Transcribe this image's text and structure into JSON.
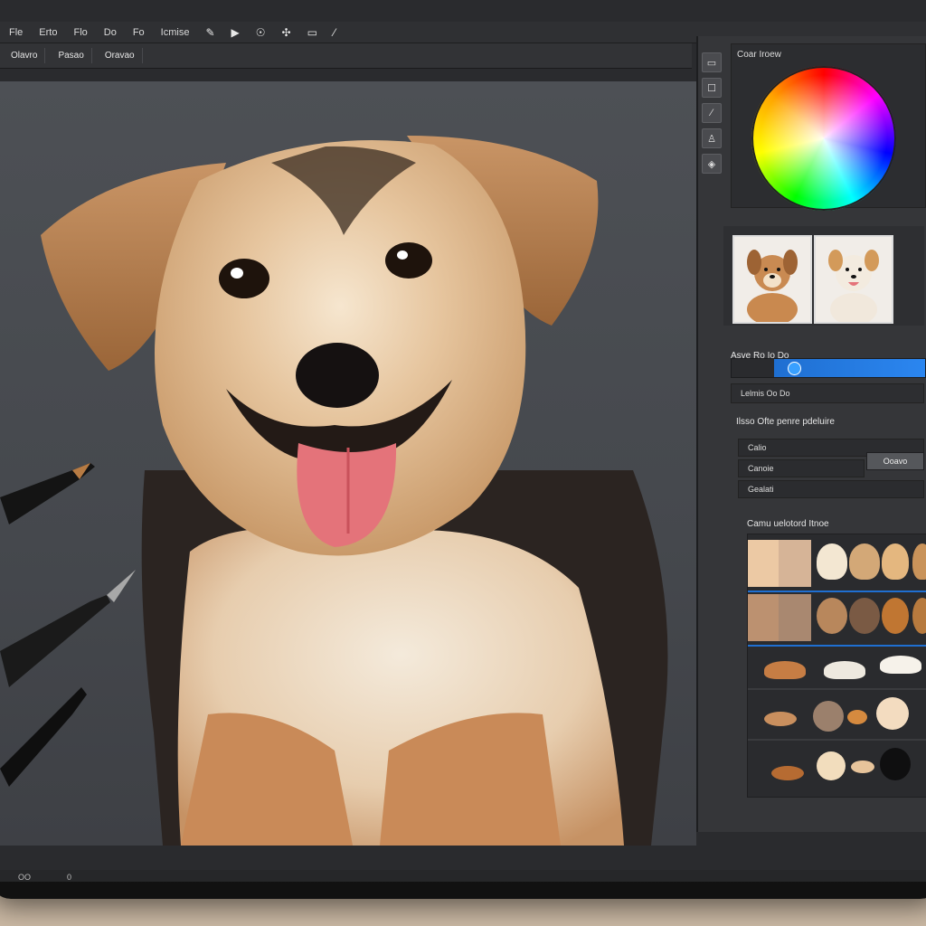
{
  "menu": {
    "items": [
      "Fle",
      "Erto",
      "Flo",
      "Do",
      "Fo",
      "Icmise"
    ],
    "tools": [
      "✎",
      "▶",
      "☉"
    ],
    "tools2": [
      "✣",
      "▭",
      "⁄"
    ]
  },
  "toolbar": {
    "items": [
      "Olavro",
      "Pasao",
      "Oravao"
    ]
  },
  "panel": {
    "color_title": "Coar Iroew",
    "layers_title": "Asve Ro Io Do",
    "layer_rows": [
      "Lelmis Oo Do"
    ],
    "props_title": "Ilsso Ofte penre pdeluire",
    "prop_rows": [
      "Calio",
      "Canoie",
      "Gealati"
    ],
    "prop_button": "Ooavo",
    "swatch_title": "Camu uelotord Itnoe"
  },
  "status": {
    "left": "OO",
    "mid": "0"
  },
  "colors": {
    "canvas": "#4a4d52",
    "panel": "#353639",
    "accent_blue": "#2b86f0",
    "swatch_skin": [
      "#f1c89f",
      "#d9b08c",
      "#c98f5c",
      "#b77942",
      "#a8601f",
      "#8d4e24",
      "#f2e1c9",
      "#1a1a1a"
    ]
  },
  "canvas_subject": {
    "alt": "Digital painting of a smiling tan-and-black puppy on gray background"
  }
}
